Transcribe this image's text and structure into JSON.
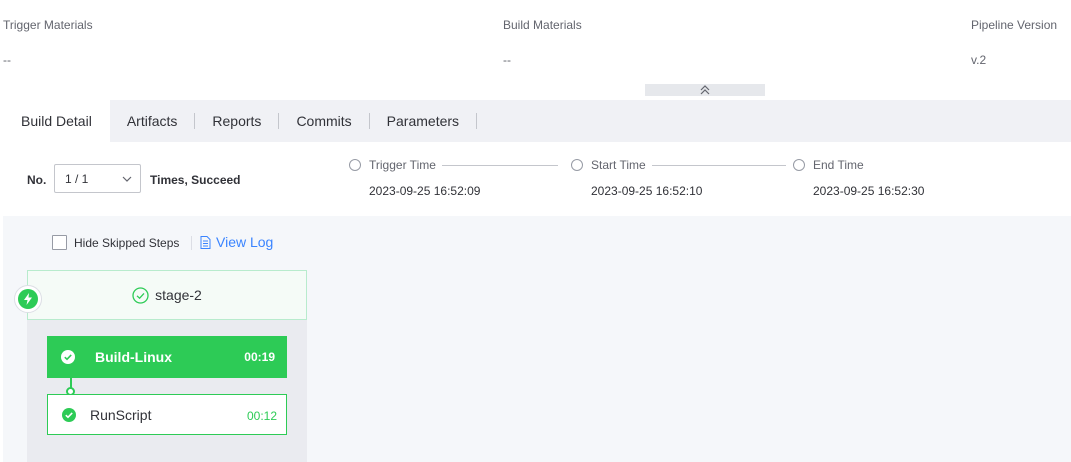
{
  "materials": {
    "trigger_label": "Trigger Materials",
    "trigger_value": "--",
    "build_label": "Build Materials",
    "build_value": "--",
    "version_label": "Pipeline Version",
    "version_value": "v.2"
  },
  "tabs": [
    {
      "label": "Build Detail",
      "active": true
    },
    {
      "label": "Artifacts"
    },
    {
      "label": "Reports"
    },
    {
      "label": "Commits"
    },
    {
      "label": "Parameters"
    }
  ],
  "info": {
    "no_label": "No.",
    "no_value": "1 / 1",
    "status_text": "Times, Succeed",
    "trigger_time_label": "Trigger Time",
    "trigger_time_value": "2023-09-25 16:52:09",
    "start_time_label": "Start Time",
    "start_time_value": "2023-09-25 16:52:10",
    "end_time_label": "End Time",
    "end_time_value": "2023-09-25 16:52:30"
  },
  "toolbar": {
    "hide_skipped_label": "Hide Skipped Steps",
    "view_log_label": "View Log"
  },
  "stage": {
    "name": "stage-2",
    "job": {
      "name": "Build-Linux",
      "duration": "00:19"
    },
    "step": {
      "name": "RunScript",
      "duration": "00:12"
    }
  },
  "colors": {
    "success": "#2dcb56",
    "link": "#3a84ff",
    "tab_bar": "#f0f1f5"
  },
  "icons": {
    "collapse": "double-chevron-up-icon",
    "dropdown": "chevron-down-icon",
    "view_log": "document-icon",
    "trigger": "lightning-icon",
    "success": "check-circle-icon"
  }
}
